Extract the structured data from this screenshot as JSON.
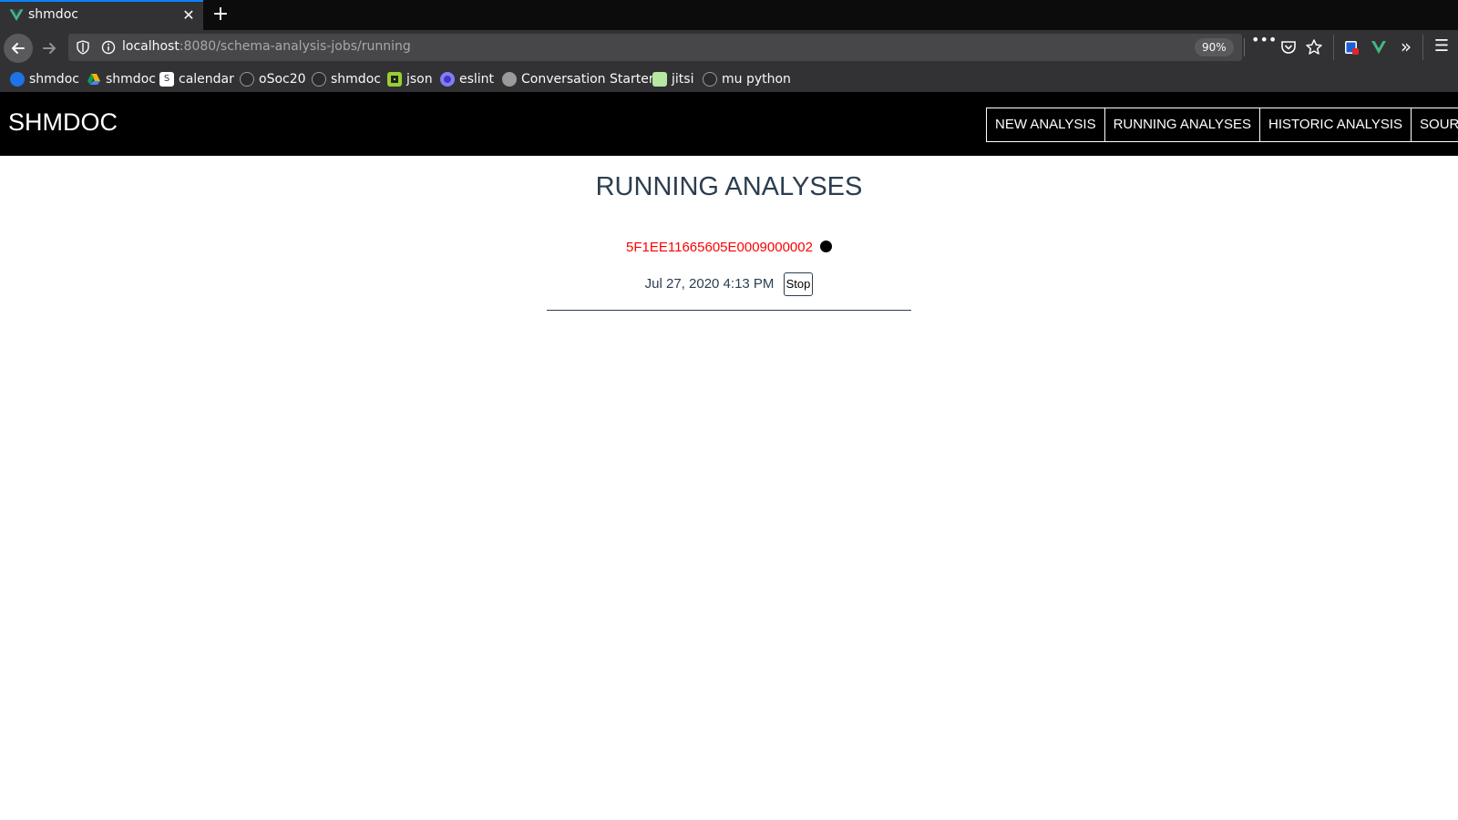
{
  "browser": {
    "tab": {
      "title": "shmdoc",
      "close_glyph": "✕"
    },
    "new_tab_glyph": "+",
    "url": {
      "host": "localhost",
      "rest": ":8080/schema-analysis-jobs/running"
    },
    "zoom": "90%",
    "toolbar_icons": [
      "more-icon",
      "pocket-icon",
      "bookmark-star-icon",
      "extension-icon",
      "vue-devtools-icon",
      "overflow-icon",
      "menu-icon"
    ],
    "bookmarks": [
      {
        "label": "shmdoc",
        "icon": "nextcloud-icon",
        "color": "#1e73e8"
      },
      {
        "label": "shmdoc",
        "icon": "drive-icon",
        "color": "#f4b400"
      },
      {
        "label": "calendar",
        "icon": "calendar-icon",
        "color": "#ffffff"
      },
      {
        "label": "oSoc20",
        "icon": "github-icon",
        "color": "#333333"
      },
      {
        "label": "shmdoc",
        "icon": "github-icon",
        "color": "#333333"
      },
      {
        "label": "json",
        "icon": "json-icon",
        "color": "#9acd32"
      },
      {
        "label": "eslint",
        "icon": "eslint-icon",
        "color": "#4b32c3"
      },
      {
        "label": "Conversation Starter",
        "icon": "globe-icon",
        "color": "#9a9a9a"
      },
      {
        "label": "jitsi",
        "icon": "jitsi-icon",
        "color": "#b5e8a0"
      },
      {
        "label": "mu python",
        "icon": "github-icon",
        "color": "#333333"
      }
    ]
  },
  "app": {
    "brand": "SHMDOC",
    "nav": [
      "NEW ANALYSIS",
      "RUNNING ANALYSES",
      "HISTORIC ANALYSIS",
      "SOURCES"
    ],
    "page_title": "RUNNING ANALYSES",
    "jobs": [
      {
        "id": "5F1EE11665605E0009000002",
        "timestamp": "Jul 27, 2020 4:13 PM",
        "stop_label": "Stop"
      }
    ],
    "colors": {
      "job_id": "#ff0000",
      "text": "#2c3e50"
    }
  }
}
